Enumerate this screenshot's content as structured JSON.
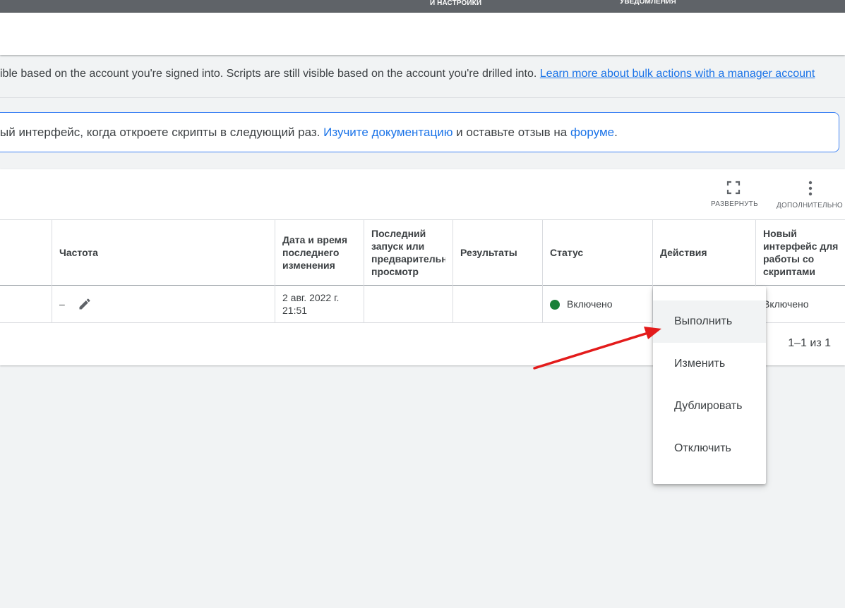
{
  "topbar": {
    "tools_label": "И НАСТРОЙКИ",
    "notifications_label": "УВЕДОМЛЕНИЯ"
  },
  "notice": {
    "text": "ible based on the account you're signed into. Scripts are still visible based on the account you're drilled into. ",
    "link": "Learn more about bulk actions with a manager account"
  },
  "banner": {
    "text_before": "ый интерфейс, когда откроете скрипты в следующий раз. ",
    "docs_link": "Изучите документацию",
    "text_middle": " и оставьте отзыв на ",
    "forum_link": "форуме",
    "text_after": "."
  },
  "toolbar": {
    "expand_label": "РАЗВЕРНУТЬ",
    "more_label": "ДОПОЛНИТЕЛЬНО",
    "expand_icon": "fullscreen-icon",
    "more_icon": "more-vert-icon"
  },
  "table": {
    "headers": {
      "frequency": "Частота",
      "modified_line1": "Дата и время",
      "modified_line2": "последнего",
      "modified_line3": "изменения",
      "last_run_line1": "Последний",
      "last_run_line2": "запуск или",
      "last_run_line3": "предварительный",
      "last_run_line4": "просмотр",
      "results": "Результаты",
      "status": "Статус",
      "actions": "Действия",
      "new_ui_line1": "Новый",
      "new_ui_line2": "интерфейс для",
      "new_ui_line3": "работы со",
      "new_ui_line4": "скриптами"
    },
    "rows": [
      {
        "frequency": "–",
        "modified_line1": "2 авг. 2022 г.",
        "modified_line2": "21:51",
        "status": "Включено",
        "new_ui": "Включено"
      }
    ],
    "pagination": "1–1 из 1",
    "status_color": "#188038"
  },
  "menu": {
    "items": [
      "Выполнить",
      "Изменить",
      "Дублировать",
      "Отключить"
    ]
  },
  "annotation": {
    "arrow_color": "#e31b1b"
  }
}
